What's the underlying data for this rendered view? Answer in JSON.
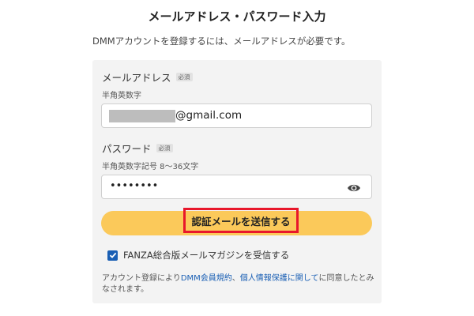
{
  "page": {
    "title": "メールアドレス・パスワード入力",
    "intro": "DMMアカウントを登録するには、メールアドレスが必要です。"
  },
  "email": {
    "label": "メールアドレス",
    "required": "必須",
    "helper": "半角英数字",
    "value_visible": "@gmail.com",
    "masked_prefix": "redacted"
  },
  "password": {
    "label": "パスワード",
    "required": "必須",
    "helper": "半角英数字記号 8～36文字",
    "value": "••••••••",
    "toggle_icon": "eye-icon"
  },
  "submit": {
    "label": "認証メールを送信する",
    "highlight_color": "#e8172b",
    "button_color": "#fbc95a"
  },
  "newsletter": {
    "label": "FANZA総合版メールマガジンを受信する",
    "checked": true
  },
  "terms": {
    "prefix": "アカウント登録により",
    "link1": "DMM会員規約",
    "sep": "、",
    "link2": "個人情報保護に関して",
    "suffix": "に同意したとみなされます。"
  },
  "colors": {
    "link": "#1a5fb4",
    "card_bg": "#f3f3f3"
  }
}
